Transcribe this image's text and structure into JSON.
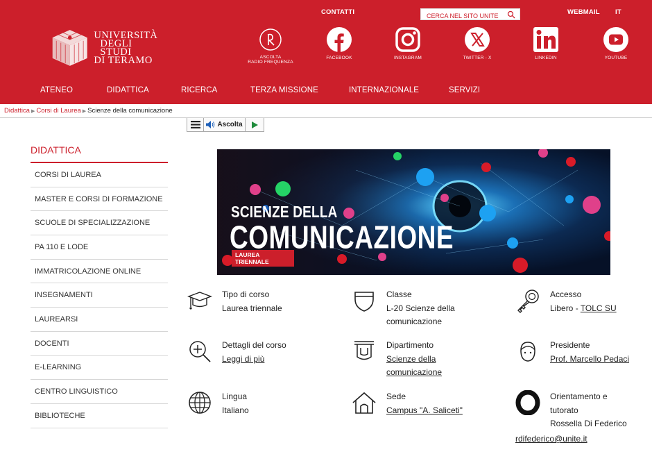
{
  "header": {
    "contatti": "CONTATTI",
    "search_placeholder": "CERCA NEL SITO UNITE",
    "webmail": "WEBMAIL",
    "lang": "IT",
    "logo_line1": "UNIVERSITÀ",
    "logo_line2": "DEGLI STUDI",
    "logo_line3": "DI TERAMO",
    "radio_label1": "ASCOLTA",
    "radio_label2": "RADIO FREQUENZA",
    "social": [
      {
        "label": "FACEBOOK",
        "icon": "facebook-icon"
      },
      {
        "label": "INSTAGRAM",
        "icon": "instagram-icon"
      },
      {
        "label": "TWITTER - X",
        "icon": "twitter-x-icon"
      },
      {
        "label": "LINKEDIN",
        "icon": "linkedin-icon"
      },
      {
        "label": "YOUTUBE",
        "icon": "youtube-icon"
      }
    ],
    "brand_color": "#cc1f2b"
  },
  "nav": [
    "ATENEO",
    "DIDATTICA",
    "RICERCA",
    "TERZA MISSIONE",
    "INTERNAZIONALE",
    "SERVIZI"
  ],
  "breadcrumb": [
    "Didattica",
    "Corsi di Laurea",
    "Scienze della comunicazione"
  ],
  "listen": {
    "label": "Ascolta"
  },
  "sidebar": {
    "title": "DIDATTICA",
    "items": [
      "CORSI DI LAUREA",
      "MASTER E CORSI DI FORMAZIONE",
      "SCUOLE DI SPECIALIZZAZIONE",
      "PA 110 E LODE",
      "IMMATRICOLAZIONE ONLINE",
      "INSEGNAMENTI",
      "LAUREARSI",
      "DOCENTI",
      "E-LEARNING",
      "CENTRO LINGUISTICO",
      "BIBLIOTECHE"
    ]
  },
  "banner": {
    "line1": "SCIENZE DELLA",
    "line2": "COMUNICAZIONE",
    "tag": "LAUREA TRIENNALE"
  },
  "info": {
    "tipo": {
      "label": "Tipo di corso",
      "value": "Laurea triennale"
    },
    "classe": {
      "label": "Classe",
      "value": "L-20 Scienze della comunicazione"
    },
    "accesso": {
      "label": "Accesso",
      "value_prefix": "Libero - ",
      "link": "TOLC SU"
    },
    "dettagli": {
      "label": "Dettagli del corso",
      "link": "Leggi di più"
    },
    "dipartimento": {
      "label": "Dipartimento",
      "link": "Scienze della comunicazione"
    },
    "presidente": {
      "label": "Presidente",
      "link": "Prof. Marcello Pedaci"
    },
    "lingua": {
      "label": "Lingua",
      "value": "Italiano"
    },
    "sede": {
      "label": "Sede",
      "link": "Campus \"A. Saliceti\""
    },
    "orientamento": {
      "label": "Orientamento e tutorato",
      "value": "Rossella Di Federico",
      "link": "rdifederico@unite.it"
    }
  }
}
